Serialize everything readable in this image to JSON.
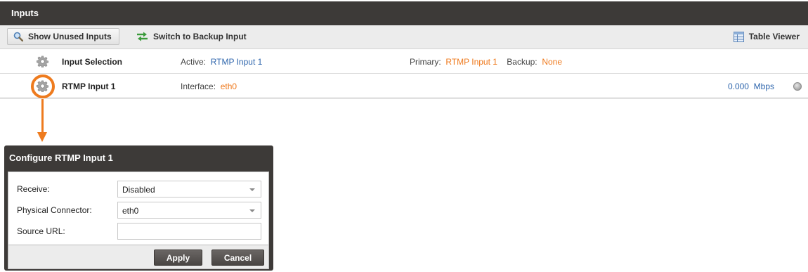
{
  "panel": {
    "title": "Inputs"
  },
  "toolbar": {
    "show_unused_label": "Show Unused Inputs",
    "switch_backup_label": "Switch to Backup Input",
    "table_viewer_label": "Table Viewer"
  },
  "rows": [
    {
      "name": "Input Selection",
      "detail_label": "Active:",
      "detail_value": "RTMP Input 1",
      "primary_label": "Primary:",
      "primary_value": "RTMP Input 1",
      "backup_label": "Backup:",
      "backup_value": "None"
    },
    {
      "name": "RTMP Input 1",
      "detail_label": "Interface:",
      "detail_value": "eth0",
      "rate_value": "0.000",
      "rate_unit": "Mbps"
    }
  ],
  "dialog": {
    "title": "Configure RTMP Input 1",
    "fields": [
      {
        "label": "Receive:",
        "value": "Disabled"
      },
      {
        "label": "Physical Connector:",
        "value": "eth0"
      },
      {
        "label": "Source URL:",
        "value": ""
      }
    ],
    "apply_label": "Apply",
    "cancel_label": "Cancel"
  },
  "colors": {
    "header_bg": "#3d3a38",
    "accent_orange": "#ee7b1e",
    "link_blue": "#2f66ad"
  },
  "icons": {
    "show_unused": "magnifier-icon",
    "switch_backup": "switch-arrows-icon",
    "table_viewer": "table-icon",
    "row_settings": "gear-icon",
    "status": "status-led-icon"
  }
}
